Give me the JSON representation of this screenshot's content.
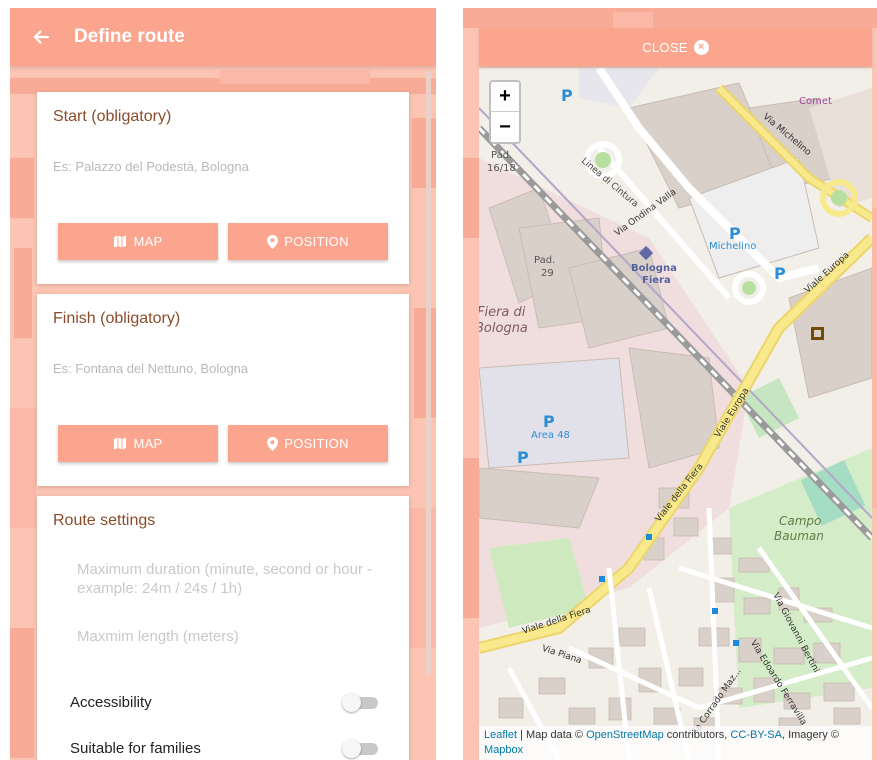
{
  "left": {
    "appbar": {
      "title": "Define route",
      "back_icon": "arrow-left-icon"
    },
    "start_card": {
      "title": "Start (obligatory)",
      "placeholder": "Es: Palazzo del Podestà, Bologna",
      "value": "",
      "map_button": "MAP",
      "position_button": "POSITION"
    },
    "finish_card": {
      "title": "Finish (obligatory)",
      "placeholder": "Es: Fontana del Nettuno, Bologna",
      "value": "",
      "map_button": "MAP",
      "position_button": "POSITION"
    },
    "settings_card": {
      "title": "Route settings",
      "max_duration_placeholder": "Maximum duration (minute, second or hour - example: 24m / 24s / 1h)",
      "max_length_placeholder": "Maxmim length (meters)",
      "toggles": [
        {
          "label": "Accessibility",
          "on": false
        },
        {
          "label": "Suitable for families",
          "on": false
        }
      ]
    },
    "colors": {
      "accent": "#fba58f",
      "background": "#fcc4b3",
      "title_text": "#8b4c2c"
    }
  },
  "right": {
    "close_label": "CLOSE",
    "zoom": {
      "in": "+",
      "out": "−"
    },
    "map_labels": {
      "parking": "P",
      "pad_1618": [
        "Pad.",
        "16/18"
      ],
      "pad_29": [
        "Pad.",
        "29"
      ],
      "bologna_fiera": [
        "Bologna",
        "Fiera"
      ],
      "michelino": "Michelino",
      "fiera_di_bologna": [
        "Fiera di",
        "Bologna"
      ],
      "area_48": "Area 48",
      "campo_bauman": [
        "Campo",
        "Bauman"
      ],
      "comet": "Comet",
      "streets": {
        "via_michelino": "Via Michelino",
        "viale_europa": "Viale Europa",
        "viale_della_fiera": "Viale della Fiera",
        "via_ondina_valla": "Via Ondina Valla",
        "linea_di_cintura": "Linea di Cintura",
        "via_piana": "Via Piana",
        "via_giovanni_bertini": "Via Giovanni Bertini",
        "via_edoardo_ferravilla": "Via Edoardo Ferravilla",
        "via_corrado_mazza": "Via Corrado Maz..."
      }
    },
    "attribution": {
      "leaflet": "Leaflet",
      "text1": " | Map data © ",
      "osm": "OpenStreetMap",
      "text2": " contributors, ",
      "license": "CC-BY-SA",
      "text3": ", Imagery © ",
      "mapbox": "Mapbox"
    }
  }
}
